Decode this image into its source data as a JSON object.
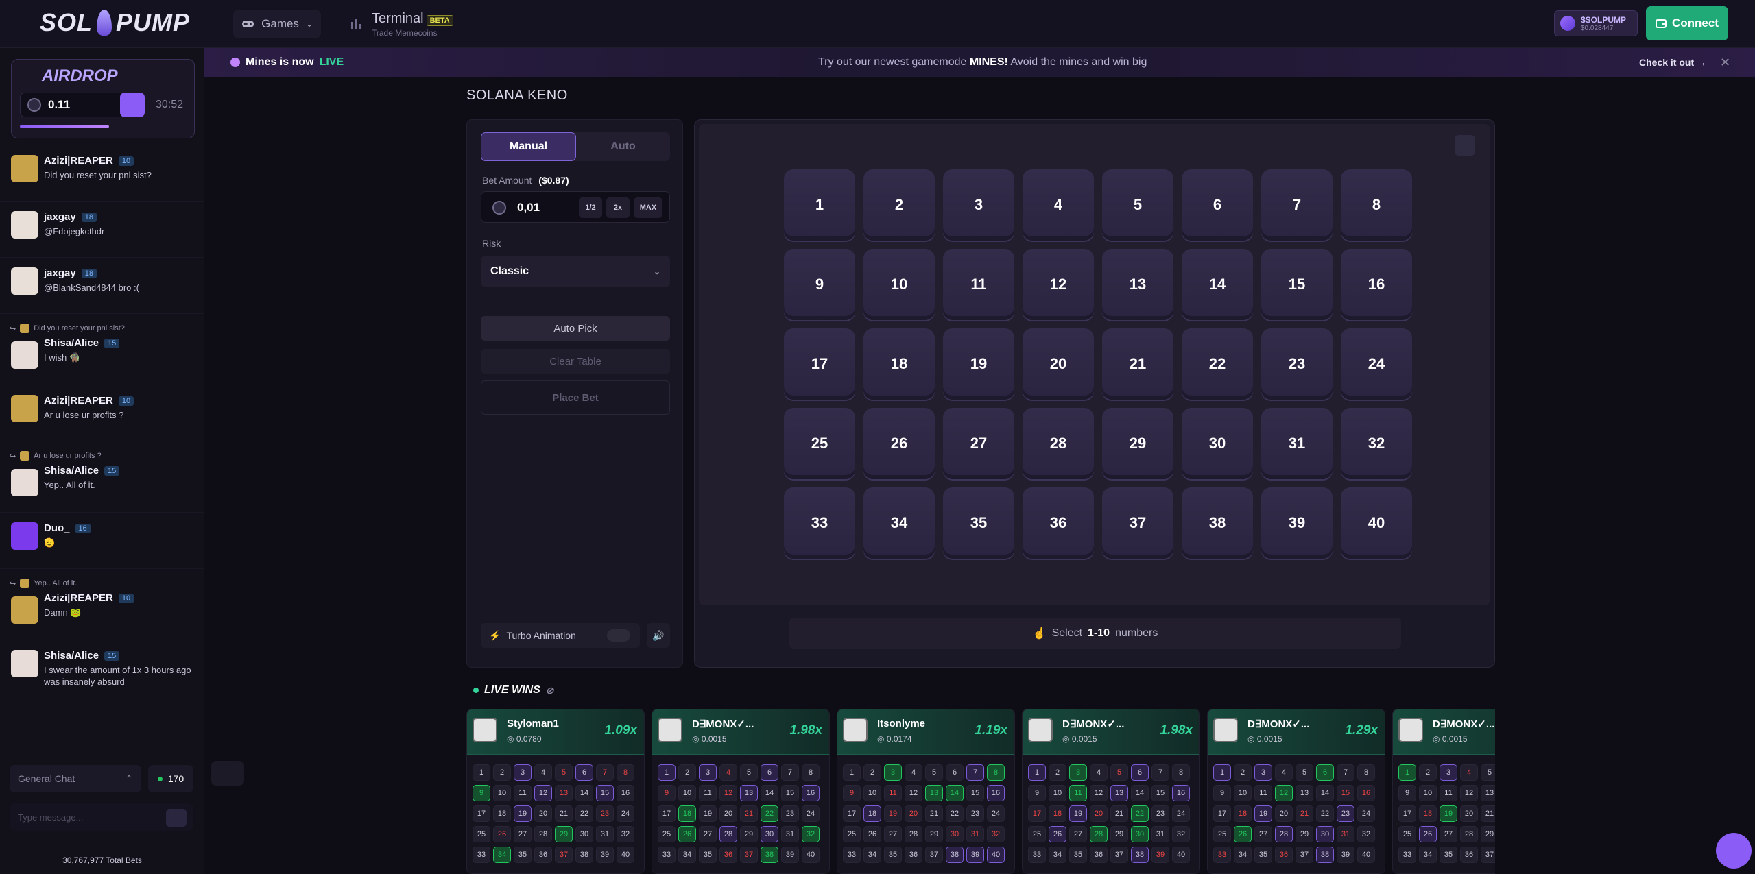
{
  "header": {
    "logo_left": "SOL",
    "logo_right": "PUMP",
    "games_label": "Games",
    "terminal_label": "Terminal",
    "terminal_badge": "BETA",
    "terminal_sub": "Trade Memecoins",
    "token_name": "$SOLPUMP",
    "token_price": "$0.028447",
    "connect_label": "Connect"
  },
  "airdrop": {
    "title": "AIRDROP",
    "amount": "0.11",
    "timer": "30:52",
    "progress_fraction": 0.5
  },
  "chat": {
    "messages": [
      {
        "user": "Azizi|REAPER",
        "level": "10",
        "text": "Did you reset your pnl sist?",
        "reply": ""
      },
      {
        "user": "jaxgay",
        "level": "18",
        "text": "@Fdojegkcthdr",
        "reply": ""
      },
      {
        "user": "jaxgay",
        "level": "18",
        "text": "@BlankSand4844 bro :(",
        "reply": ""
      },
      {
        "user": "Shisa/Alice",
        "level": "15",
        "text": "I wish 🧌",
        "reply": "Did you reset your pnl sist?"
      },
      {
        "user": "Azizi|REAPER",
        "level": "10",
        "text": "Ar u lose ur profits ?",
        "reply": ""
      },
      {
        "user": "Shisa/Alice",
        "level": "15",
        "text": "Yep.. All of it.",
        "reply": "Ar u lose ur profits ?"
      },
      {
        "user": "Duo_",
        "level": "16",
        "text": "🫡",
        "reply": ""
      },
      {
        "user": "Azizi|REAPER",
        "level": "10",
        "text": "Damn 🐸",
        "reply": "Yep.. All of it."
      },
      {
        "user": "Shisa/Alice",
        "level": "15",
        "text": "I swear the amount of 1x 3 hours ago was insanely absurd",
        "reply": ""
      }
    ],
    "channel": "General Chat",
    "online": "170",
    "input_placeholder": "Type message...",
    "total_bets": "30,767,977 Total Bets"
  },
  "banner": {
    "left_text": "Mines is now",
    "left_live": "LIVE",
    "middle_pre": "Try out our newest gamemode",
    "middle_bold": "MINES!",
    "middle_post": "Avoid the mines and win big",
    "cta": "Check it out →",
    "close": "✕"
  },
  "game": {
    "title": "SOLANA KENO",
    "tab_manual": "Manual",
    "tab_auto": "Auto",
    "bet_label": "Bet Amount",
    "bet_usd": "($0.87)",
    "bet_value": "0,01",
    "half": "1/2",
    "double": "2x",
    "max": "MAX",
    "risk_label": "Risk",
    "risk_value": "Classic",
    "auto_pick": "Auto Pick",
    "clear_table": "Clear Table",
    "place_bet": "Place Bet",
    "turbo": "Turbo Animation",
    "hint_pre": "Select",
    "hint_range": "1-10",
    "hint_post": "numbers"
  },
  "tiles": [
    "1",
    "2",
    "3",
    "4",
    "5",
    "6",
    "7",
    "8",
    "9",
    "10",
    "11",
    "12",
    "13",
    "14",
    "15",
    "16",
    "17",
    "18",
    "19",
    "20",
    "21",
    "22",
    "23",
    "24",
    "25",
    "26",
    "27",
    "28",
    "29",
    "30",
    "31",
    "32",
    "33",
    "34",
    "35",
    "36",
    "37",
    "38",
    "39",
    "40"
  ],
  "live_wins": {
    "title": "LIVE WINS",
    "cards": [
      {
        "name": "Styloman1",
        "amount": "0.0780",
        "mult": "1.09x",
        "picks": [
          3,
          6,
          12,
          15,
          19,
          34
        ],
        "hits": [
          9,
          29,
          34
        ],
        "misses": [
          5,
          7,
          8,
          13,
          23,
          26,
          37
        ]
      },
      {
        "name": "D∃MONX✓...",
        "amount": "0.0015",
        "mult": "1.98x",
        "picks": [
          1,
          3,
          6,
          13,
          16,
          28,
          30
        ],
        "hits": [
          18,
          22,
          26,
          32,
          38
        ],
        "misses": [
          4,
          9,
          12,
          21,
          36,
          37
        ]
      },
      {
        "name": "Itsonlyme",
        "amount": "0.0174",
        "mult": "1.19x",
        "picks": [
          7,
          14,
          16,
          18,
          38,
          39,
          40
        ],
        "hits": [
          3,
          8,
          13,
          14
        ],
        "misses": [
          9,
          11,
          19,
          20,
          30,
          31,
          32
        ]
      },
      {
        "name": "D∃MONX✓...",
        "amount": "0.0015",
        "mult": "1.98x",
        "picks": [
          1,
          6,
          13,
          16,
          19,
          26,
          38
        ],
        "hits": [
          3,
          11,
          22,
          28,
          30
        ],
        "misses": [
          5,
          16,
          17,
          18,
          20,
          39
        ]
      },
      {
        "name": "D∃MONX✓...",
        "amount": "0.0015",
        "mult": "1.29x",
        "picks": [
          1,
          3,
          19,
          23,
          28,
          30,
          38
        ],
        "hits": [
          6,
          12,
          26
        ],
        "misses": [
          15,
          16,
          18,
          21,
          31,
          33,
          36
        ]
      },
      {
        "name": "D∃MONX✓...",
        "amount": "0.0015",
        "mult": "",
        "picks": [
          3,
          26
        ],
        "hits": [
          1,
          19
        ],
        "misses": [
          4,
          18
        ]
      }
    ]
  }
}
